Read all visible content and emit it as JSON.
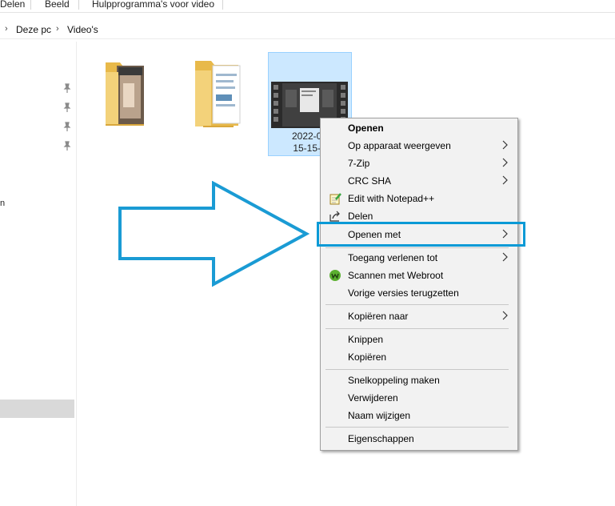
{
  "ribbon": {
    "tabs": [
      "Delen",
      "Beeld",
      "Hulpprogramma's voor video"
    ]
  },
  "address": {
    "crumbs": [
      "Deze pc",
      "Video's"
    ]
  },
  "nav": {
    "partial_label": "n"
  },
  "files": [
    {
      "name": ""
    },
    {
      "name": ""
    },
    {
      "name_line1": "2022-02",
      "name_line2": "15-15-1",
      "selected": true
    }
  ],
  "context_menu": {
    "items": [
      {
        "label": "Openen",
        "bold": true
      },
      {
        "label": "Op apparaat weergeven",
        "submenu": true
      },
      {
        "label": "7-Zip",
        "submenu": true
      },
      {
        "label": "CRC SHA",
        "submenu": true
      },
      {
        "label": "Edit with Notepad++",
        "icon": "notepad-plus-plus-icon"
      },
      {
        "label": "Delen",
        "icon": "share-icon"
      },
      {
        "label": "Openen met",
        "submenu": true,
        "highlighted": true
      },
      {
        "label": "Toegang verlenen tot",
        "submenu": true
      },
      {
        "label": "Scannen met Webroot",
        "icon": "webroot-icon"
      },
      {
        "label": "Vorige versies terugzetten"
      },
      {
        "label": "Kopiëren naar",
        "submenu": true
      },
      {
        "label": "Knippen"
      },
      {
        "label": "Kopiëren"
      },
      {
        "label": "Snelkoppeling maken"
      },
      {
        "label": "Verwijderen"
      },
      {
        "label": "Naam wijzigen"
      },
      {
        "label": "Eigenschappen"
      }
    ]
  },
  "colors": {
    "highlight_box": "#0a9ad6",
    "arrow_outline": "#1a9bd4",
    "selection_bg": "#cce8ff",
    "menu_bg": "#f2f2f2"
  }
}
